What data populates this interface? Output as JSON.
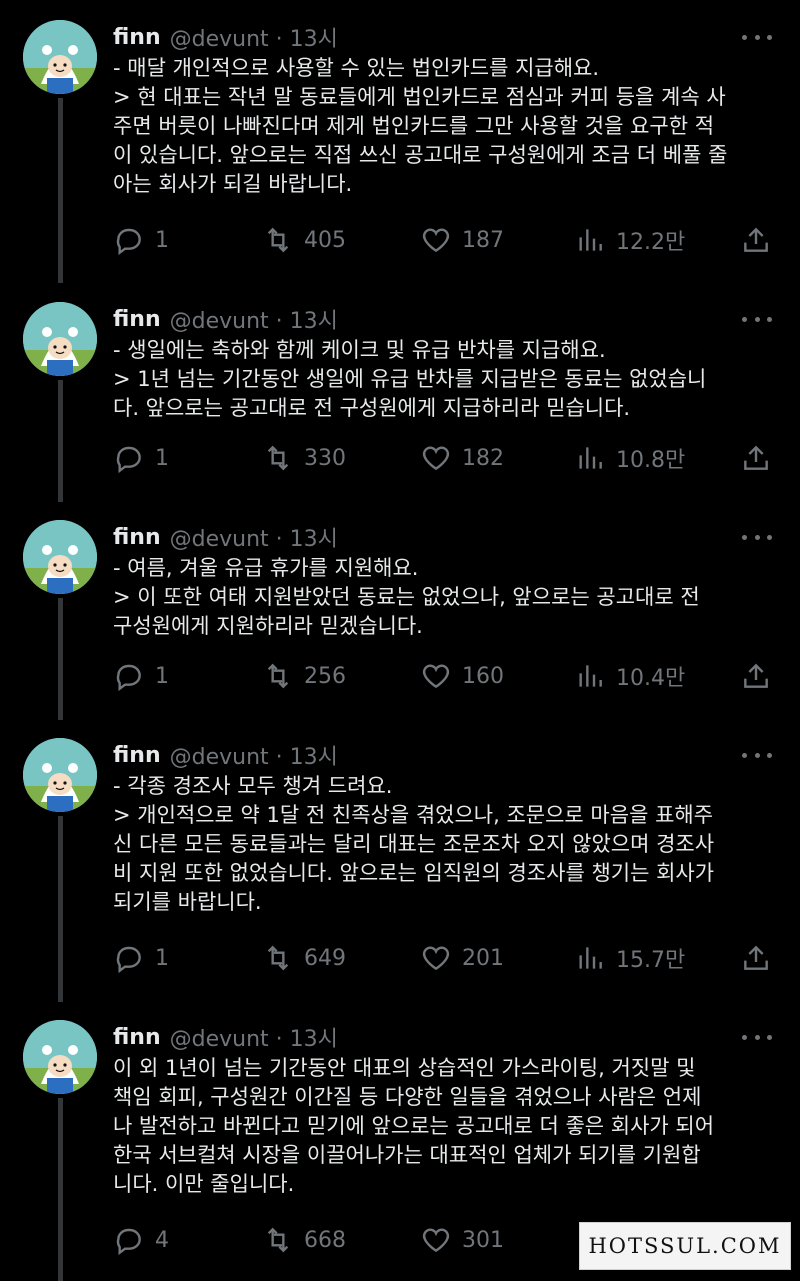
{
  "colors": {
    "background": "#000000",
    "text": "#e7e9ea",
    "muted": "#71767b",
    "thread_line": "#333639"
  },
  "tweets": [
    {
      "name": "finn",
      "meta": "@devunt · 13시",
      "text": "- 매달 개인적으로 사용할 수 있는 법인카드를 지급해요.\n> 현 대표는 작년 말 동료들에게 법인카드로 점심과 커피 등을 계속 사\n주면 버릇이 나빠진다며 제게 법인카드를 그만 사용할 것을 요구한 적\n이 있습니다. 앞으로는 직접 쓰신 공고대로 구성원에게 조금 더 베풀 줄\n아는 회사가 되길 바랍니다.",
      "replies": "1",
      "retweets": "405",
      "likes": "187",
      "views": "12.2만"
    },
    {
      "name": "finn",
      "meta": "@devunt · 13시",
      "text": "- 생일에는 축하와 함께 케이크 및 유급 반차를 지급해요.\n> 1년 넘는 기간동안 생일에 유급 반차를 지급받은 동료는 없었습니\n다. 앞으로는 공고대로 전 구성원에게 지급하리라 믿습니다.",
      "replies": "1",
      "retweets": "330",
      "likes": "182",
      "views": "10.8만"
    },
    {
      "name": "finn",
      "meta": "@devunt · 13시",
      "text": "- 여름, 겨울 유급 휴가를 지원해요.\n> 이 또한 여태 지원받았던 동료는 없었으나, 앞으로는 공고대로 전\n구성원에게 지원하리라 믿겠습니다.",
      "replies": "1",
      "retweets": "256",
      "likes": "160",
      "views": "10.4만"
    },
    {
      "name": "finn",
      "meta": "@devunt · 13시",
      "text": "- 각종 경조사 모두 챙겨 드려요.\n> 개인적으로 약 1달 전 친족상을 겪었으나, 조문으로 마음을 표해주\n신 다른 모든 동료들과는 달리 대표는 조문조차 오지 않았으며 경조사\n비 지원 또한 없었습니다. 앞으로는 임직원의 경조사를 챙기는 회사가\n되기를 바랍니다.",
      "replies": "1",
      "retweets": "649",
      "likes": "201",
      "views": "15.7만"
    },
    {
      "name": "finn",
      "meta": "@devunt · 13시",
      "text": "이 외 1년이 넘는 기간동안 대표의 상습적인 가스라이팅, 거짓말 및\n책임 회피, 구성원간 이간질 등 다양한 일들을 겪었으나 사람은 언제\n나 발전하고 바뀐다고 믿기에 앞으로는 공고대로 더 좋은 회사가 되어\n한국 서브컬쳐 시장을 이끌어나가는 대표적인 업체가 되기를 기원합\n니다. 이만 줄입니다.",
      "replies": "4",
      "retweets": "668",
      "likes": "301",
      "views": ""
    }
  ],
  "watermark": "HOTSSUL.COM"
}
